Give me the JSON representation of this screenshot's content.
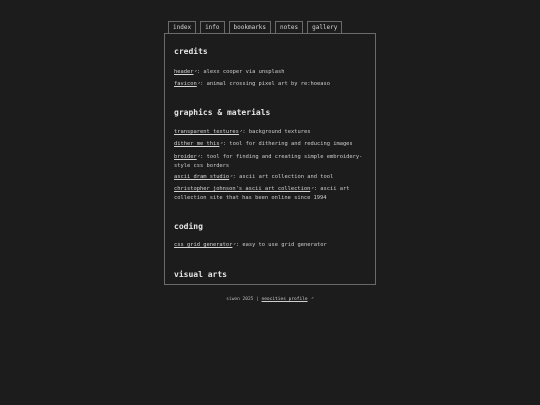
{
  "nav": {
    "tabs": [
      "index",
      "info",
      "bookmarks",
      "notes",
      "gallery"
    ]
  },
  "sections": [
    {
      "title": "credits",
      "entries": [
        {
          "link": "header",
          "text": ": alexx cooper via unsplash"
        },
        {
          "link": "favicon",
          "text": ": animal crossing pixel art by re:hoeaso"
        }
      ]
    },
    {
      "title": "graphics & materials",
      "entries": [
        {
          "link": "transparent textures",
          "text": ": background textures"
        },
        {
          "link": "dither me this",
          "text": ": tool for dithering and reducing images"
        },
        {
          "link": "broider",
          "text": ": tool for finding and creating simple embroidery-style css borders"
        },
        {
          "link": "ascii dram studio",
          "text": ": ascii art collection and tool"
        },
        {
          "link": "christopher johnson's ascii art collection",
          "text": ": ascii art collection site that has been online since 1994"
        }
      ]
    },
    {
      "title": "coding",
      "entries": [
        {
          "link": "css grid generator",
          "text": ": easy to use grid generator"
        }
      ]
    },
    {
      "title": "visual arts",
      "entries": []
    }
  ],
  "footer": {
    "text": "siwon 2025 | ",
    "link": "neocities profile",
    "ext": "↗"
  },
  "icons": {
    "external_link": "↗"
  }
}
